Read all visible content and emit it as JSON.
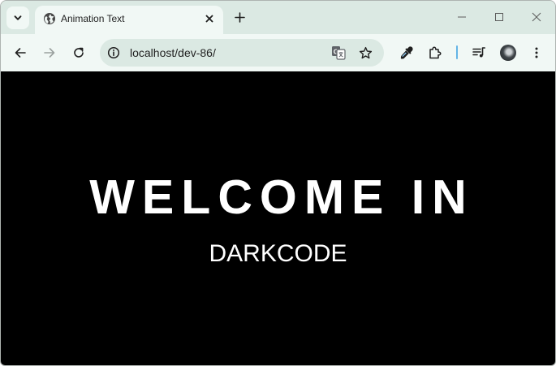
{
  "browser": {
    "tab": {
      "title": "Animation Text"
    },
    "omnibox": {
      "host": "localhost",
      "path": "/dev-86/"
    },
    "colors": {
      "frame": "#dbe9e3",
      "toolbar": "#f1f8f5",
      "divider": "#63b4e6"
    },
    "icons": {
      "tab_search": "chevron-down-icon",
      "favicon": "globe-icon",
      "tab_close": "close-icon",
      "new_tab": "plus-icon",
      "minimize": "minimize-icon",
      "maximize": "maximize-icon",
      "close_window": "close-icon",
      "back": "arrow-left-icon",
      "forward": "arrow-right-icon",
      "reload": "reload-icon",
      "site_info": "info-icon",
      "translate": "translate-icon",
      "bookmark": "star-icon",
      "eyedropper": "eyedropper-icon",
      "extensions": "puzzle-icon",
      "media": "queue-music-icon",
      "profile": "avatar",
      "menu": "kebab-menu-icon"
    }
  },
  "page": {
    "background": "#000000",
    "headline": "WELCOME IN",
    "subline": "DARKCODE"
  }
}
